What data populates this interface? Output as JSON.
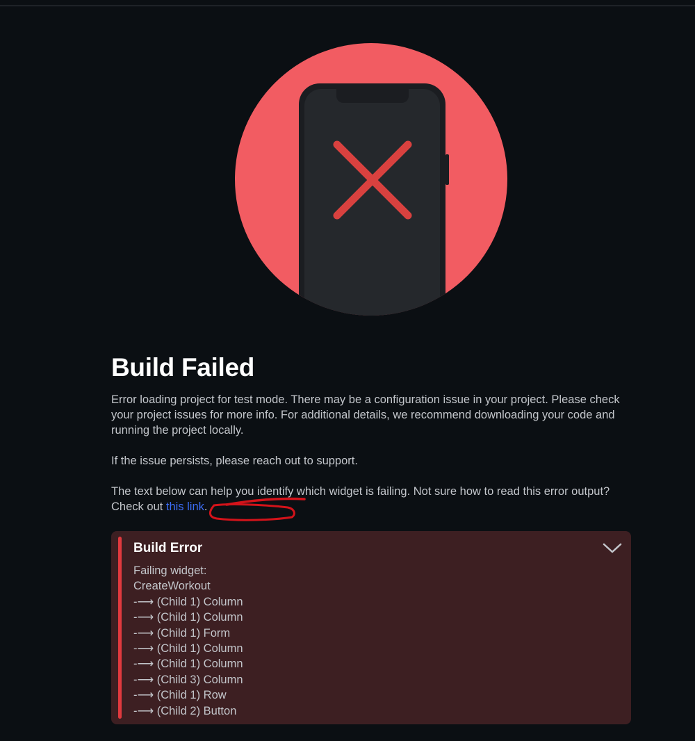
{
  "colors": {
    "background": "#0b0f13",
    "circle": "#f25c62",
    "phone_body": "#25282c",
    "cross": "#d9413f",
    "error_panel_bg": "#3d1f22",
    "error_accent": "#e0393e",
    "link": "#3b6cf6",
    "annotation": "#d3131a"
  },
  "icons": {
    "illustration": "phone-with-x-icon",
    "collapse": "chevron-down-icon"
  },
  "main": {
    "title": "Build Failed",
    "paragraph1": "Error loading project for test mode. There may be a configuration issue in your project. Please check your project issues for more info. For additional details, we recommend downloading your code and running the project locally.",
    "paragraph2": "If the issue persists, please reach out to support.",
    "paragraph3_prefix": "The text below can help you identify which widget is failing. Not sure how to read this error output? Check out ",
    "paragraph3_link": "this link",
    "paragraph3_suffix": "."
  },
  "build_error": {
    "title": "Build Error",
    "lines": [
      "Failing widget:",
      "CreateWorkout",
      "-⟶ (Child 1) Column",
      "-⟶ (Child 1) Column",
      "-⟶ (Child 1) Form",
      "-⟶ (Child 1) Column",
      "-⟶ (Child 1) Column",
      "-⟶ (Child 3) Column",
      "-⟶ (Child 1) Row",
      "-⟶ (Child 2) Button"
    ]
  }
}
